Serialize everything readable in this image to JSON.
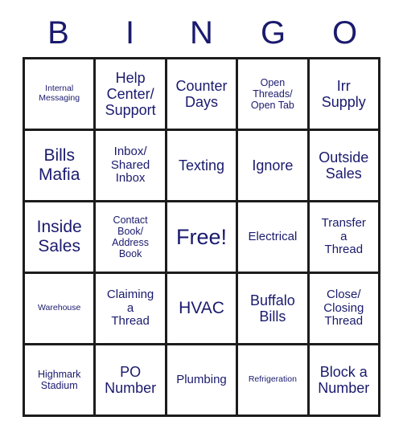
{
  "card": {
    "title": "BINGO",
    "headers": [
      "B",
      "I",
      "N",
      "G",
      "O"
    ],
    "accent_color": "#1a1a6e",
    "border_color": "#1c1c1c",
    "background_color": "#ffffff",
    "columns": 5,
    "rows": 5,
    "cells": [
      {
        "text": "Internal\nMessaging",
        "size": "xs"
      },
      {
        "text": "Help\nCenter/\nSupport",
        "size": "l"
      },
      {
        "text": "Counter\nDays",
        "size": "l"
      },
      {
        "text": "Open\nThreads/\nOpen Tab",
        "size": "s"
      },
      {
        "text": "Irr\nSupply",
        "size": "l"
      },
      {
        "text": "Bills\nMafia",
        "size": "xl"
      },
      {
        "text": "Inbox/\nShared\nInbox",
        "size": "m"
      },
      {
        "text": "Texting",
        "size": "l"
      },
      {
        "text": "Ignore",
        "size": "l"
      },
      {
        "text": "Outside\nSales",
        "size": "l"
      },
      {
        "text": "Inside\nSales",
        "size": "xl"
      },
      {
        "text": "Contact\nBook/\nAddress\nBook",
        "size": "s"
      },
      {
        "text": "Free!",
        "size": "free"
      },
      {
        "text": "Electrical",
        "size": "m"
      },
      {
        "text": "Transfer\na\nThread",
        "size": "m"
      },
      {
        "text": "Warehouse",
        "size": "xs"
      },
      {
        "text": "Claiming\na\nThread",
        "size": "m"
      },
      {
        "text": "HVAC",
        "size": "xl"
      },
      {
        "text": "Buffalo\nBills",
        "size": "l"
      },
      {
        "text": "Close/\nClosing\nThread",
        "size": "m"
      },
      {
        "text": "Highmark\nStadium",
        "size": "s"
      },
      {
        "text": "PO\nNumber",
        "size": "l"
      },
      {
        "text": "Plumbing",
        "size": "m"
      },
      {
        "text": "Refrigeration",
        "size": "xs"
      },
      {
        "text": "Block a\nNumber",
        "size": "l"
      }
    ]
  }
}
